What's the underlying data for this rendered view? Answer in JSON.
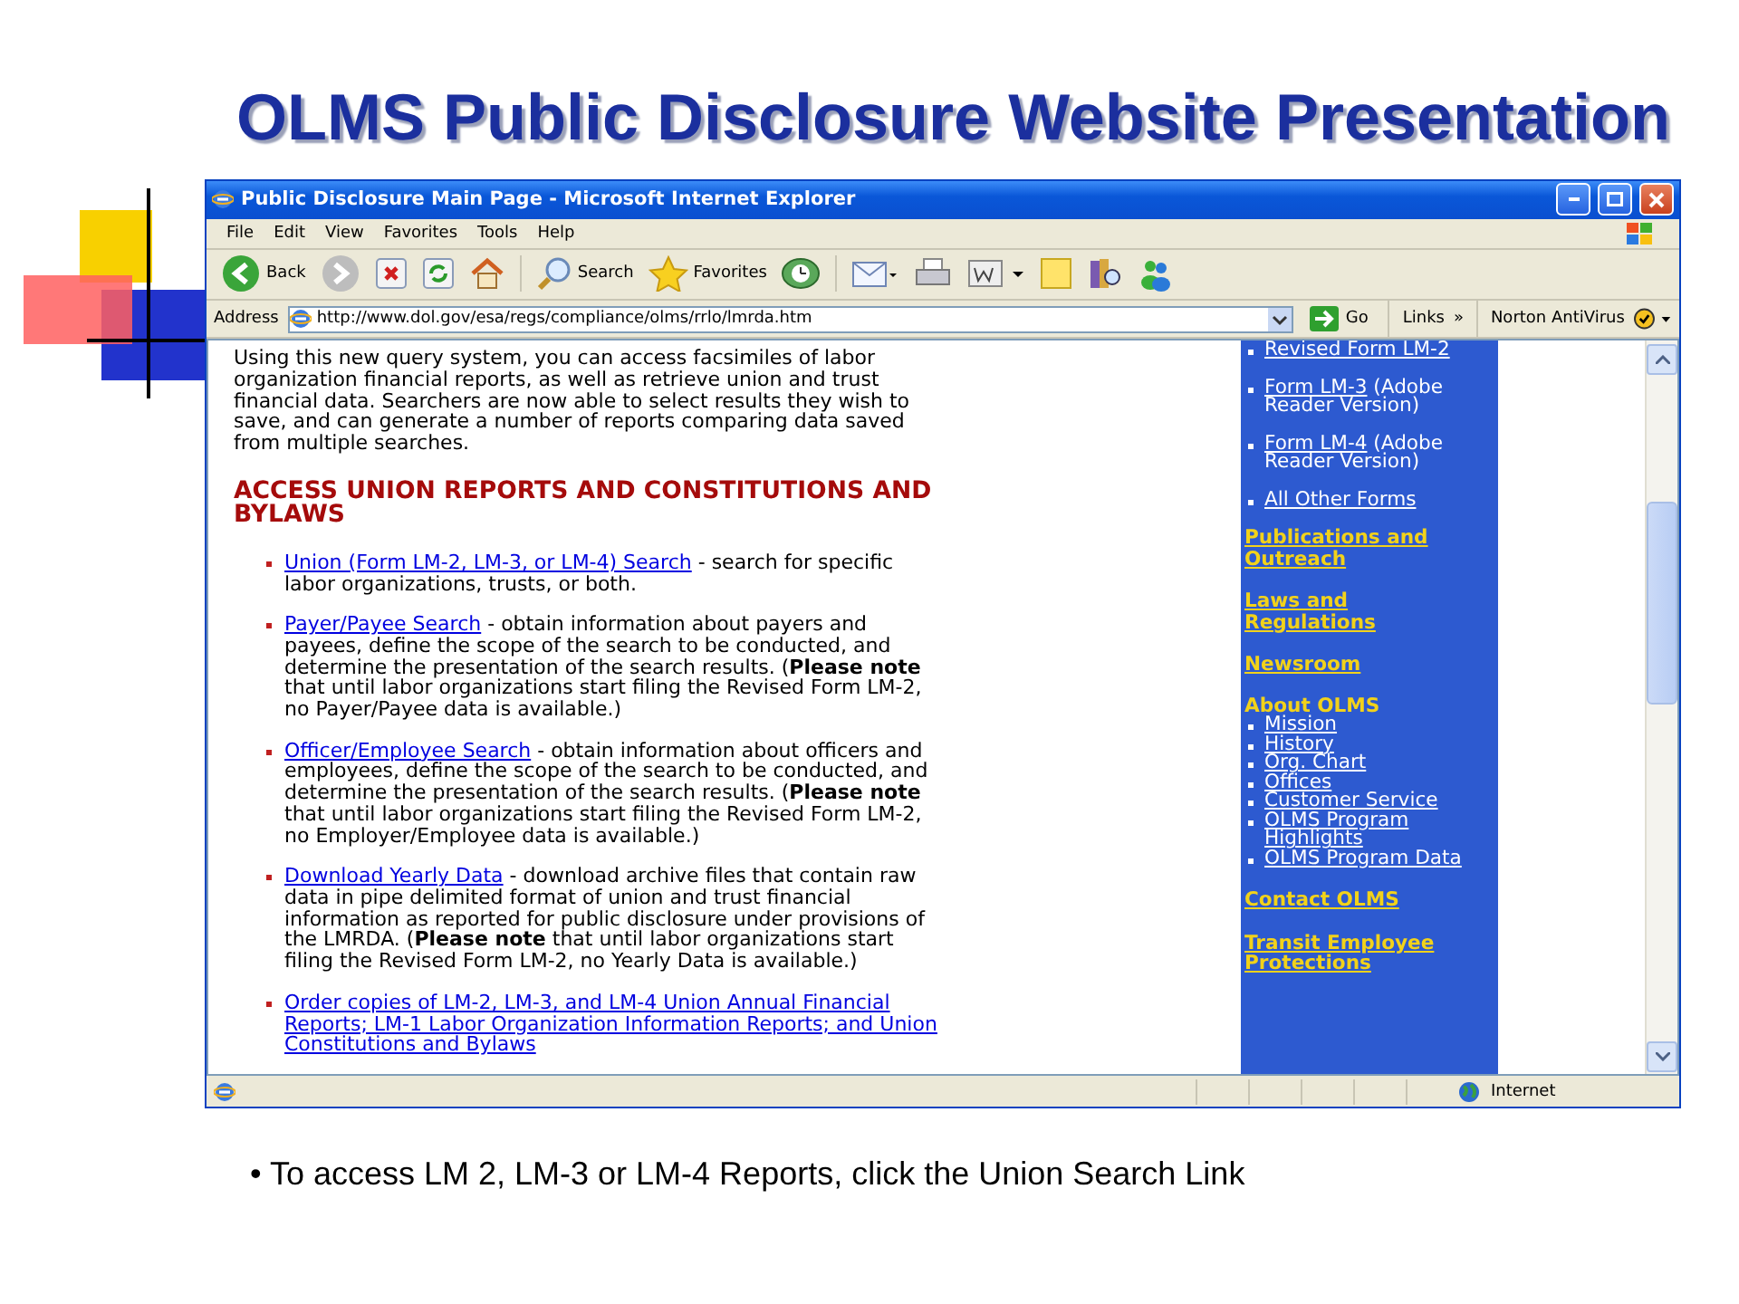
{
  "slide_title": "OLMS Public Disclosure Website Presentation",
  "window": {
    "title": "Public Disclosure Main Page - Microsoft Internet Explorer"
  },
  "menu": [
    "File",
    "Edit",
    "View",
    "Favorites",
    "Tools",
    "Help"
  ],
  "toolbar": [
    {
      "kind": "back",
      "label": "Back"
    },
    {
      "kind": "forward"
    },
    {
      "kind": "stop"
    },
    {
      "kind": "refresh"
    },
    {
      "kind": "home"
    },
    {
      "kind": "search",
      "label": "Search"
    },
    {
      "kind": "favorites",
      "label": "Favorites"
    },
    {
      "kind": "media"
    },
    {
      "kind": "mail"
    },
    {
      "kind": "print"
    },
    {
      "kind": "edit"
    },
    {
      "kind": "note"
    },
    {
      "kind": "research"
    },
    {
      "kind": "messenger"
    }
  ],
  "address": {
    "label": "Address",
    "url": "http://www.dol.gov/esa/regs/compliance/olms/rrlo/lmrda.htm",
    "go": "Go",
    "links": "Links",
    "links_more": "»",
    "norton": "Norton AntiVirus"
  },
  "content": {
    "intro": "Using this new query system, you can access facsimiles of labor organization financial reports, as well as retrieve union and trust financial data. Searchers are now able to select results they wish to save, and can generate a number of reports comparing data saved from multiple searches.",
    "heading": "ACCESS UNION REPORTS AND CONSTITUTIONS AND BYLAWS",
    "items": [
      {
        "link": "Union (Form LM-2, LM-3, or LM-4) Search",
        "text": " - search for specific labor organizations, trusts, or both."
      },
      {
        "link": "Payer/Payee Search",
        "text": " - obtain information about payers and payees, define the scope of the search to be conducted, and determine the presentation of the search results. (**Please note** that until labor organizations start filing the Revised Form LM-2, no Payer/Payee data is available.)"
      },
      {
        "link": "Officer/Employee Search",
        "text": " - obtain information about officers and employees, define the scope of the search to be conducted, and determine the presentation of the search results. (**Please note** that until labor organizations start filing the Revised Form LM-2, no Employer/Employee data is available.)"
      },
      {
        "link": "Download Yearly Data",
        "text": " - download archive files that contain raw data in pipe delimited format of union and trust financial information as reported for public disclosure under provisions of the LMRDA. (**Please note** that until labor organizations start filing the Revised Form LM-2, no Yearly Data is available.)"
      },
      {
        "link": "Order copies of LM-2, LM-3, and LM-4 Union Annual Financial Reports; LM-1 Labor Organization Information Reports; and Union Constitutions and Bylaws"
      }
    ]
  },
  "sidebar": [
    {
      "kind": "form",
      "link": "Revised Form LM-2"
    },
    {
      "kind": "form",
      "link": "Form LM-3",
      "note": "(Adobe Reader Version)"
    },
    {
      "kind": "form",
      "link": "Form LM-4",
      "note": "(Adobe Reader Version)"
    },
    {
      "kind": "form",
      "link": "All Other Forms"
    },
    {
      "kind": "section",
      "label": "Publications and Outreach"
    },
    {
      "kind": "section",
      "label": "Laws and Regulations"
    },
    {
      "kind": "section",
      "label": "Newsroom"
    },
    {
      "kind": "group",
      "label": "About OLMS",
      "items": [
        "Mission",
        "History",
        "Org. Chart",
        "Offices",
        "Customer Service",
        "OLMS Program Highlights",
        "OLMS Program Data"
      ]
    },
    {
      "kind": "section",
      "label": "Contact OLMS"
    },
    {
      "kind": "section",
      "label": "Transit Employee Protections"
    }
  ],
  "status_bar": {
    "zone": "Internet"
  },
  "note": "• To access LM 2, LM-3 or LM-4 Reports, click the Union Search Link"
}
